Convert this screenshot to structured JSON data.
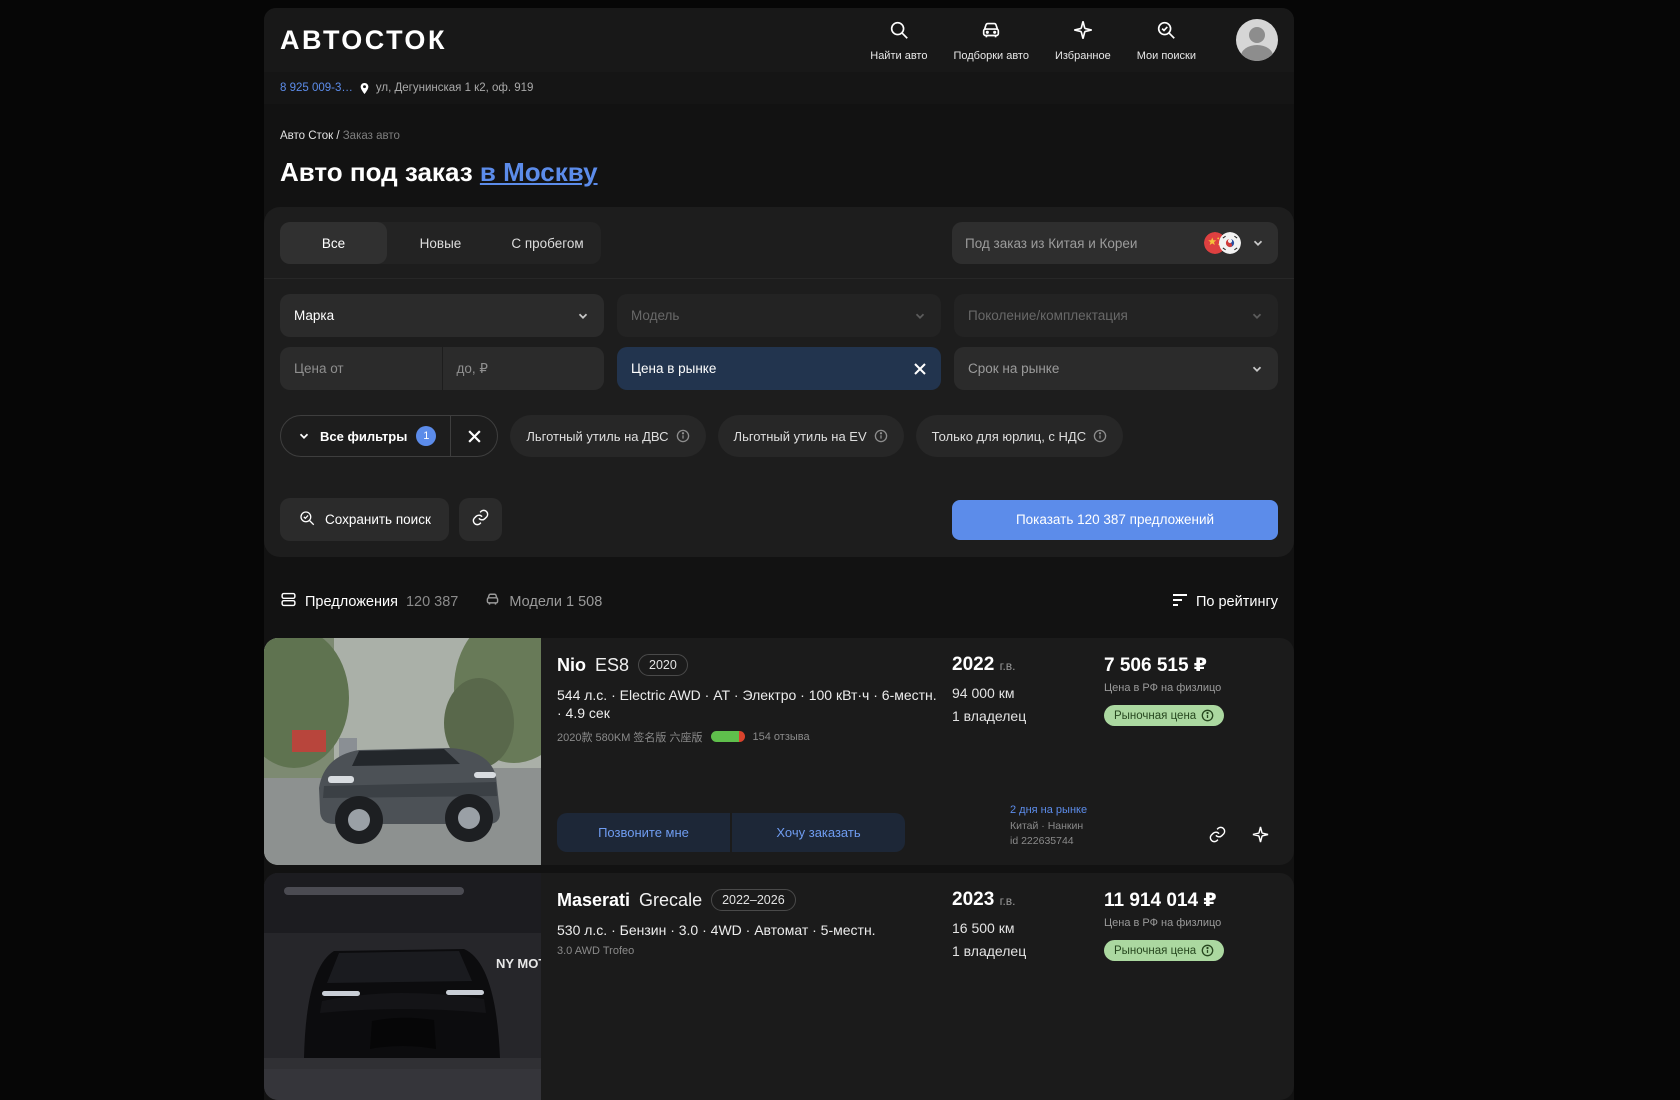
{
  "brand": {
    "logo": "АВТОСТОК"
  },
  "header": {
    "nav": [
      {
        "icon": "search-icon",
        "label": "Найти авто"
      },
      {
        "icon": "car-icon",
        "label": "Подборки авто"
      },
      {
        "icon": "sparkle-icon",
        "label": "Избранное"
      },
      {
        "icon": "search-check-icon",
        "label": "Мои поиски"
      }
    ]
  },
  "contact": {
    "phone": "8 925 009-3…",
    "address": "ул, Дегунинская 1 к2, оф. 919"
  },
  "breadcrumb": {
    "root": "Авто Сток /",
    "current": "Заказ авто"
  },
  "page": {
    "title": "Авто под заказ",
    "title_link": "в Москву"
  },
  "filters": {
    "tabs": [
      {
        "label": "Все"
      },
      {
        "label": "Новые"
      },
      {
        "label": "С пробегом"
      }
    ],
    "origin_select": "Под заказ из Китая и Кореи",
    "fields": {
      "brand": "Марка",
      "model": "Модель",
      "generation": "Поколение/комплектация",
      "price_from": "Цена от",
      "price_to": "до, ₽",
      "market_price": "Цена в рынке",
      "market_term": "Срок на рынке"
    },
    "all_filters": {
      "label": "Все фильтры",
      "count": "1"
    },
    "chips": [
      {
        "label": "Льготный утиль на ДВС"
      },
      {
        "label": "Льготный утиль на EV"
      },
      {
        "label": "Только для юрлиц, с НДС"
      }
    ],
    "save_search": "Сохранить поиск",
    "submit": "Показать 120 387 предложений"
  },
  "results": {
    "offers_label": "Предложения",
    "offers_count": "120 387",
    "models_label": "Модели 1 508",
    "sort_label": "По рейтингу"
  },
  "cards": [
    {
      "brand": "Nio",
      "model": "ES8",
      "badge": "2020",
      "specs": "544 л.с. · Electric AWD · АТ · Электро · 100 кВт·ч · 6-местн. · 4.9 сек",
      "trim": "2020款 580KM 签名版 六座版",
      "reviews": "154 отзыва",
      "year": "2022",
      "year_suffix": "г.в.",
      "mileage": "94 000 км",
      "owners": "1 владелец",
      "price": "7 506 515 ₽",
      "price_note": "Цена в РФ на физлицо",
      "price_badge": "Рыночная цена",
      "btn_call": "Позвоните мне",
      "btn_order": "Хочу заказать",
      "days_on_market": "2 дня на рынке",
      "location": "Китай · Нанкин",
      "listing_id": "id 222635744"
    },
    {
      "brand": "Maserati",
      "model": "Grecale",
      "badge": "2022–2026",
      "specs": "530 л.с. · Бензин · 3.0 · 4WD · Автомат · 5-местн.",
      "trim": "3.0 AWD Trofeo",
      "image_watermark": "NY MOTO",
      "year": "2023",
      "year_suffix": "г.в.",
      "mileage": "16 500 км",
      "owners": "1 владелец",
      "price": "11 914 014 ₽",
      "price_note": "Цена в РФ на физлицо",
      "price_badge": "Рыночная цена"
    }
  ],
  "colors": {
    "accent_blue": "#5c8cea",
    "market_chip_navy": "#22344e",
    "green_badge_bg": "#abd8a0",
    "green_badge_text": "#27471f",
    "rating_green": "#5fbf4c",
    "rating_red": "#d9432c"
  }
}
